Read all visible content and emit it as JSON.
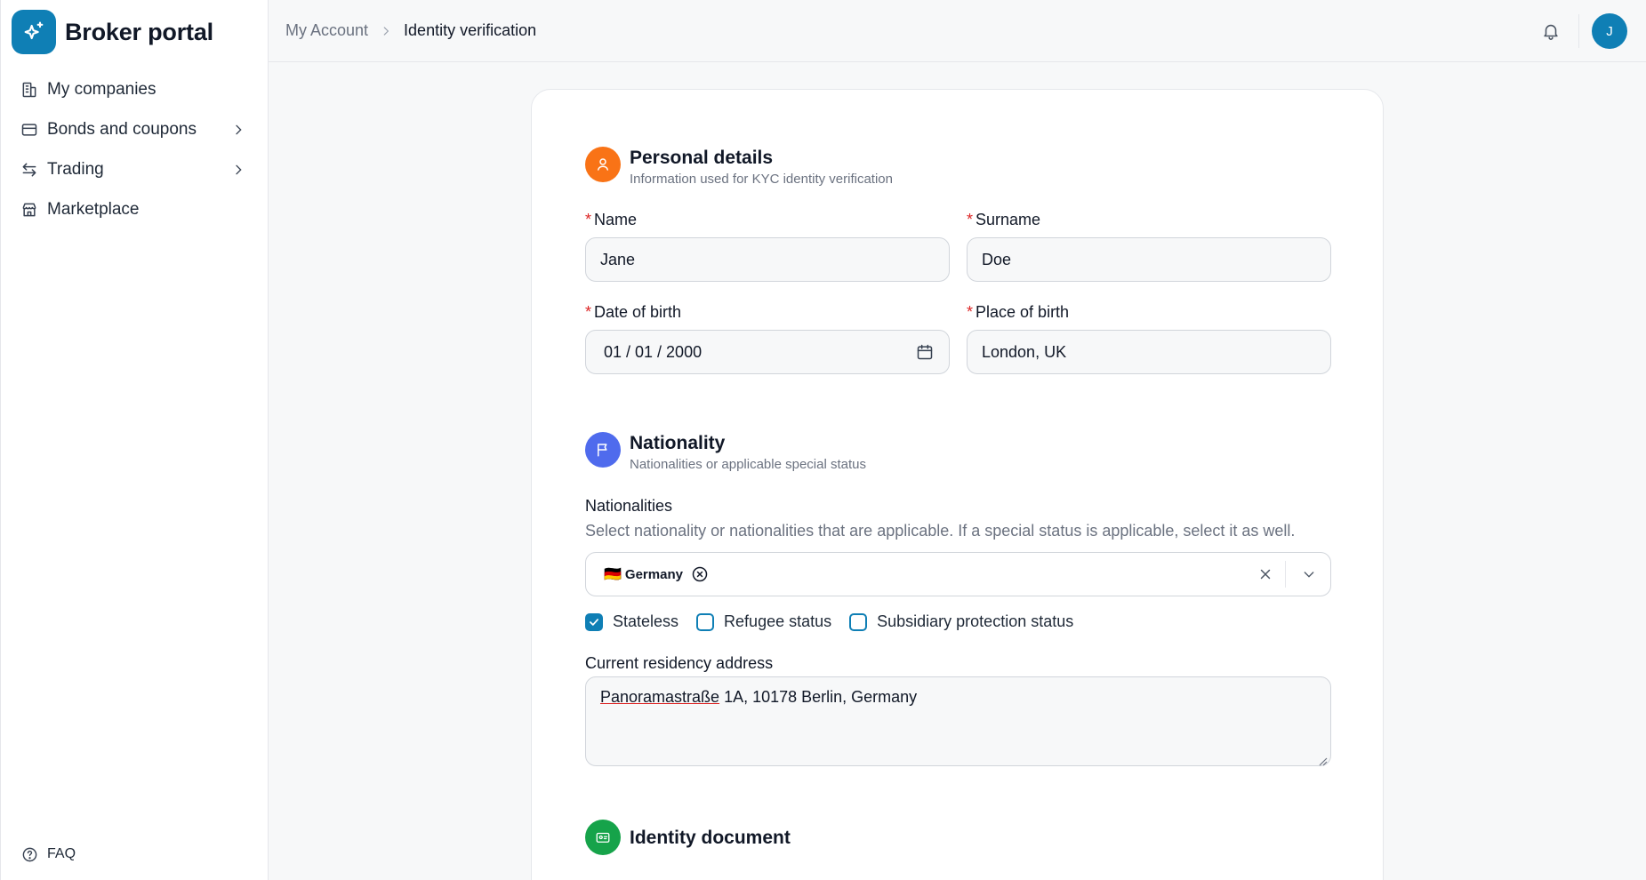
{
  "app": {
    "title": "Broker portal"
  },
  "sidebar": {
    "items": [
      {
        "label": "My companies",
        "icon": "building-icon"
      },
      {
        "label": "Bonds and coupons",
        "icon": "card-icon"
      },
      {
        "label": "Trading",
        "icon": "arrows-swap-icon"
      },
      {
        "label": "Marketplace",
        "icon": "store-icon"
      }
    ],
    "faq": "FAQ"
  },
  "header": {
    "breadcrumb": {
      "parent": "My Account",
      "current": "Identity verification"
    },
    "avatar_initial": "J"
  },
  "personal": {
    "title": "Personal details",
    "subtitle": "Information used for KYC identity verification",
    "name_label": "Name",
    "name_value": "Jane",
    "surname_label": "Surname",
    "surname_value": "Doe",
    "dob_label": "Date of birth",
    "dob_value": "01 / 01 / 2000",
    "pob_label": "Place of birth",
    "pob_value": "London, UK"
  },
  "nationality": {
    "title": "Nationality",
    "subtitle": "Nationalities or applicable special status",
    "field_label": "Nationalities",
    "helper": "Select nationality or nationalities that are applicable. If a special status is applicable, select it as well.",
    "selected": [
      {
        "flag": "🇩🇪",
        "label": "Germany"
      }
    ],
    "statuses": [
      {
        "label": "Stateless",
        "checked": true
      },
      {
        "label": "Refugee status",
        "checked": false
      },
      {
        "label": "Subsidiary protection status",
        "checked": false
      }
    ],
    "address_label": "Current residency address",
    "address_street": "Panoramastraße",
    "address_rest": " 1A, 10178 Berlin, Germany"
  },
  "identity": {
    "title": "Identity document"
  },
  "colors": {
    "brand": "#0f7fb5",
    "personal_icon_bg": "#f97316",
    "nationality_icon_bg": "#4f6bed",
    "identity_icon_bg": "#16a34a",
    "required": "#dc2626"
  }
}
